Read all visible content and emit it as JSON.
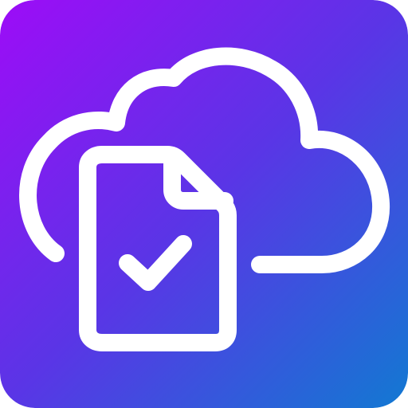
{
  "icon": {
    "name": "cloud-document-check",
    "gradient_start": "#9D0CF7",
    "gradient_mid": "#5A35E6",
    "gradient_end": "#1279D2",
    "glyph_color": "#FFFFFF"
  }
}
